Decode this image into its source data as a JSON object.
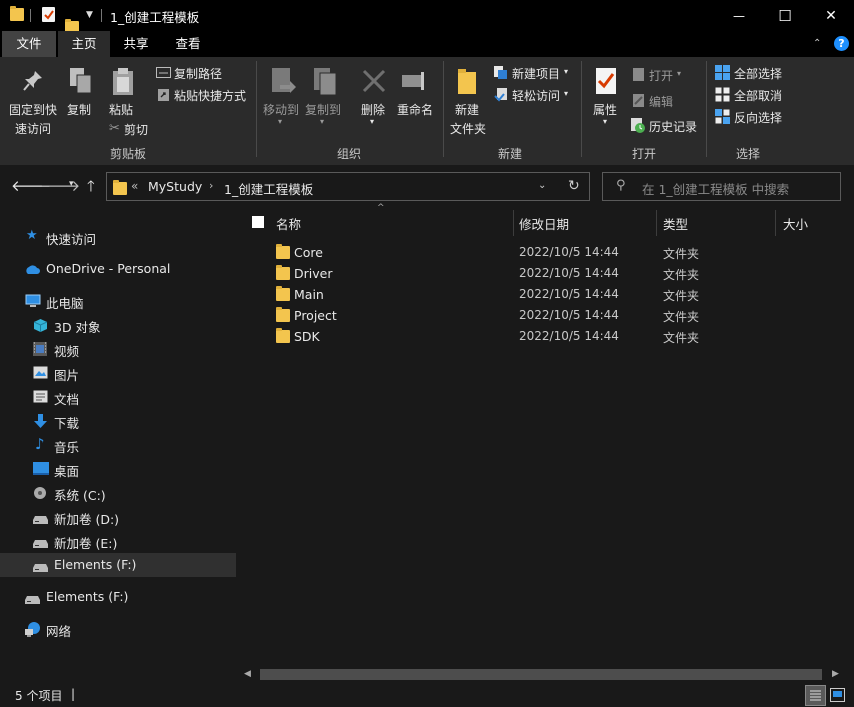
{
  "window": {
    "title": "1_创建工程模板",
    "minimize_glyph": "—",
    "maximize_glyph": "☐",
    "close_glyph": "✕"
  },
  "tabs": {
    "file": "文件",
    "home": "主页",
    "share": "共享",
    "view": "查看"
  },
  "ribbon": {
    "clipboard": {
      "pin": "固定到快\n速访问",
      "pin_l1": "固定到快",
      "pin_l2": "速访问",
      "copy": "复制",
      "paste": "粘贴",
      "copy_path": "复制路径",
      "paste_shortcut": "粘贴快捷方式",
      "cut": "剪切",
      "group": "剪贴板"
    },
    "organize": {
      "move_to": "移动到",
      "copy_to": "复制到",
      "delete": "删除",
      "rename": "重命名",
      "group": "组织"
    },
    "new": {
      "new_folder_l1": "新建",
      "new_folder_l2": "文件夹",
      "new_item": "新建项目",
      "easy_access": "轻松访问",
      "group": "新建"
    },
    "open": {
      "properties": "属性",
      "open": "打开",
      "edit": "编辑",
      "history": "历史记录",
      "group": "打开"
    },
    "select": {
      "select_all": "全部选择",
      "select_none": "全部取消",
      "invert": "反向选择",
      "group": "选择"
    }
  },
  "address": {
    "crumbs": [
      "MyStudy",
      "1_创建工程模板"
    ],
    "overflow": "«",
    "search_placeholder": "在 1_创建工程模板 中搜索"
  },
  "nav": {
    "quick_access": "快速访问",
    "onedrive": "OneDrive - Personal",
    "this_pc": "此电脑",
    "items": [
      "3D 对象",
      "视频",
      "图片",
      "文档",
      "下载",
      "音乐",
      "桌面",
      "系统 (C:)",
      "新加卷 (D:)",
      "新加卷 (E:)",
      "Elements (F:)"
    ],
    "elements": "Elements (F:)",
    "network": "网络"
  },
  "columns": {
    "name": "名称",
    "date": "修改日期",
    "type": "类型",
    "size": "大小"
  },
  "files": [
    {
      "name": "Core",
      "date": "2022/10/5 14:44",
      "type": "文件夹"
    },
    {
      "name": "Driver",
      "date": "2022/10/5 14:44",
      "type": "文件夹"
    },
    {
      "name": "Main",
      "date": "2022/10/5 14:44",
      "type": "文件夹"
    },
    {
      "name": "Project",
      "date": "2022/10/5 14:44",
      "type": "文件夹"
    },
    {
      "name": "SDK",
      "date": "2022/10/5 14:44",
      "type": "文件夹"
    }
  ],
  "status": {
    "count": "5 个项目",
    "cursor": "|"
  },
  "colors": {
    "folder": "#f3c54e",
    "ribbon_bg": "#2b2b2b",
    "window_bg": "#191919",
    "title_bg": "#000000"
  }
}
